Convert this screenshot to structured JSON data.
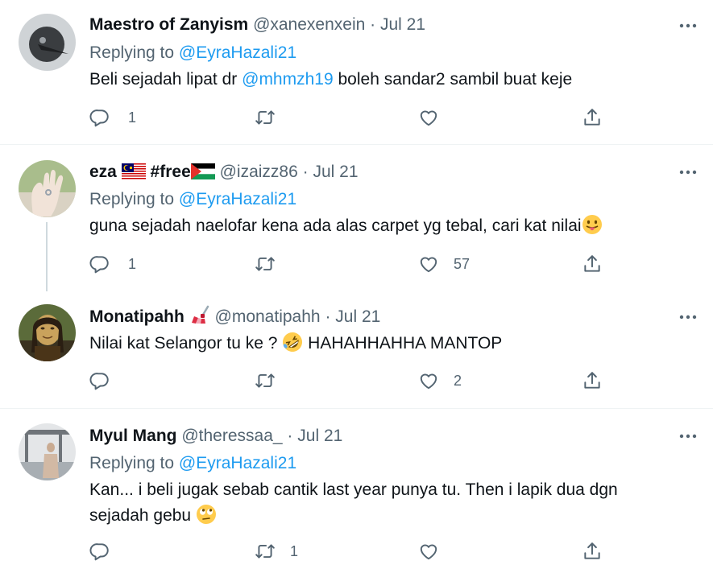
{
  "tweets": [
    {
      "name": "Maestro of Zanyism",
      "handle": "@xanexenxein",
      "dot": "·",
      "time": "Jul 21",
      "replying_prefix": "Replying to",
      "replying_to": "@EyraHazali21",
      "text_before": "Beli sejadah lipat dr",
      "text_mention": "@mhmzh19",
      "text_after": "boleh sandar2 sambil buat keje",
      "reply_count": "1",
      "retweet_count": "",
      "like_count": ""
    },
    {
      "name": "eza",
      "name_badge": "#free",
      "handle": "@izaizz86",
      "dot": "·",
      "time": "Jul 21",
      "replying_prefix": "Replying to",
      "replying_to": "@EyraHazali21",
      "text": "guna sejadah naelofar kena ada alas carpet yg tebal, cari kat nilai",
      "reply_count": "1",
      "retweet_count": "",
      "like_count": "57"
    },
    {
      "name": "Monatipahh",
      "handle": "@monatipahh",
      "dot": "·",
      "time": "Jul 21",
      "text_before": "Nilai kat Selangor tu ke ?",
      "text_after": "HAHAHHAHHA MANTOP",
      "reply_count": "",
      "retweet_count": "",
      "like_count": "2"
    },
    {
      "name": "Myul Mang",
      "handle": "@theressaa_",
      "dot": "·",
      "time": "Jul 21",
      "replying_prefix": "Replying to",
      "replying_to": "@EyraHazali21",
      "text_line1": "Kan... i beli jugak sebab cantik last year punya tu. Then i lapik dua dgn",
      "text_line2": "sejadah gebu",
      "reply_count": "",
      "retweet_count": "1",
      "like_count": ""
    }
  ],
  "icons": {
    "reply": "reply-bubble-icon",
    "retweet": "retweet-icon",
    "like": "heart-icon",
    "share": "share-icon",
    "more": "more-dots-icon"
  },
  "colors": {
    "text": "#0f1419",
    "secondary": "#536471",
    "link": "#1d9bf0",
    "divider": "#eff3f4",
    "thread": "#cfd9de"
  }
}
